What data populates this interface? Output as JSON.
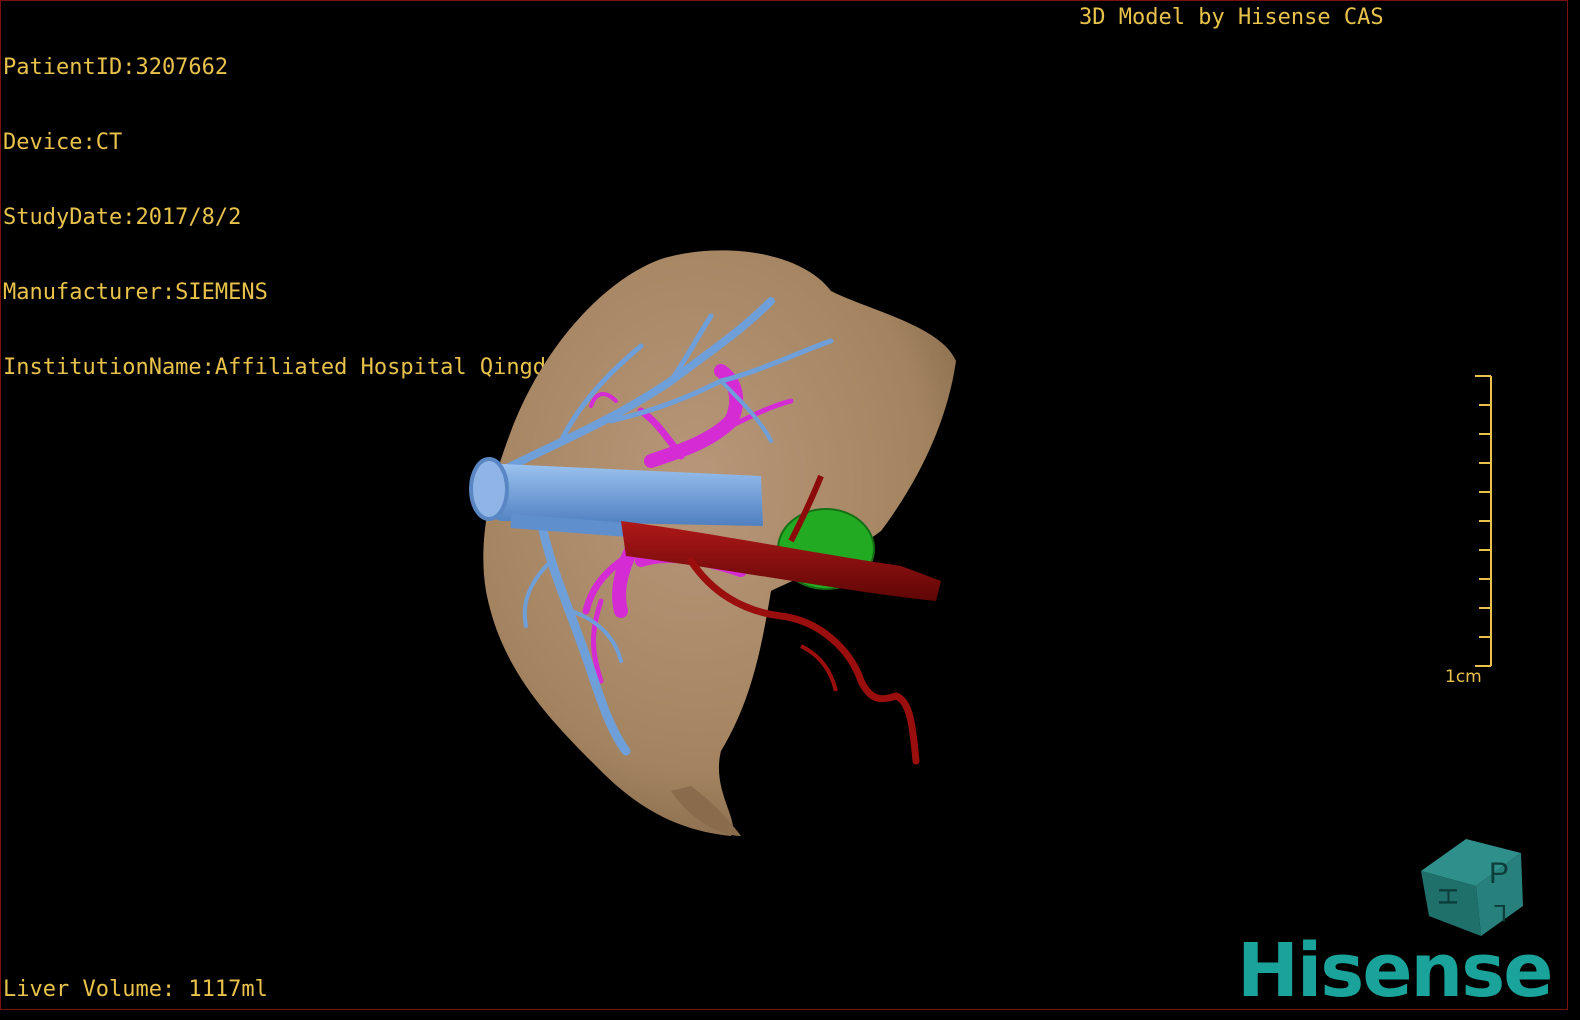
{
  "dicom_info": {
    "patient_id": "PatientID:3207662",
    "device": "Device:CT",
    "study_date": "StudyDate:2017/8/2",
    "manufacturer": "Manufacturer:SIEMENS",
    "institution": "InstitutionName:Affiliated Hospital Qingdao University-C"
  },
  "watermark_title": "3D Model by Hisense CAS",
  "liver_volume": "Liver Volume: 1117ml",
  "scale_bar": {
    "label": "1cm"
  },
  "orientation_cube": {
    "faces": [
      "P",
      "H",
      "L"
    ]
  },
  "brand": "Hisense",
  "colors": {
    "overlay_text": "#e8c24a",
    "liver": "#a98a66",
    "portal_vein": "#6f9fd8",
    "hepatic_vein": "#d42bd4",
    "artery": "#8b0b0b",
    "lesion": "#22aa22",
    "brand": "#1aa39a"
  }
}
